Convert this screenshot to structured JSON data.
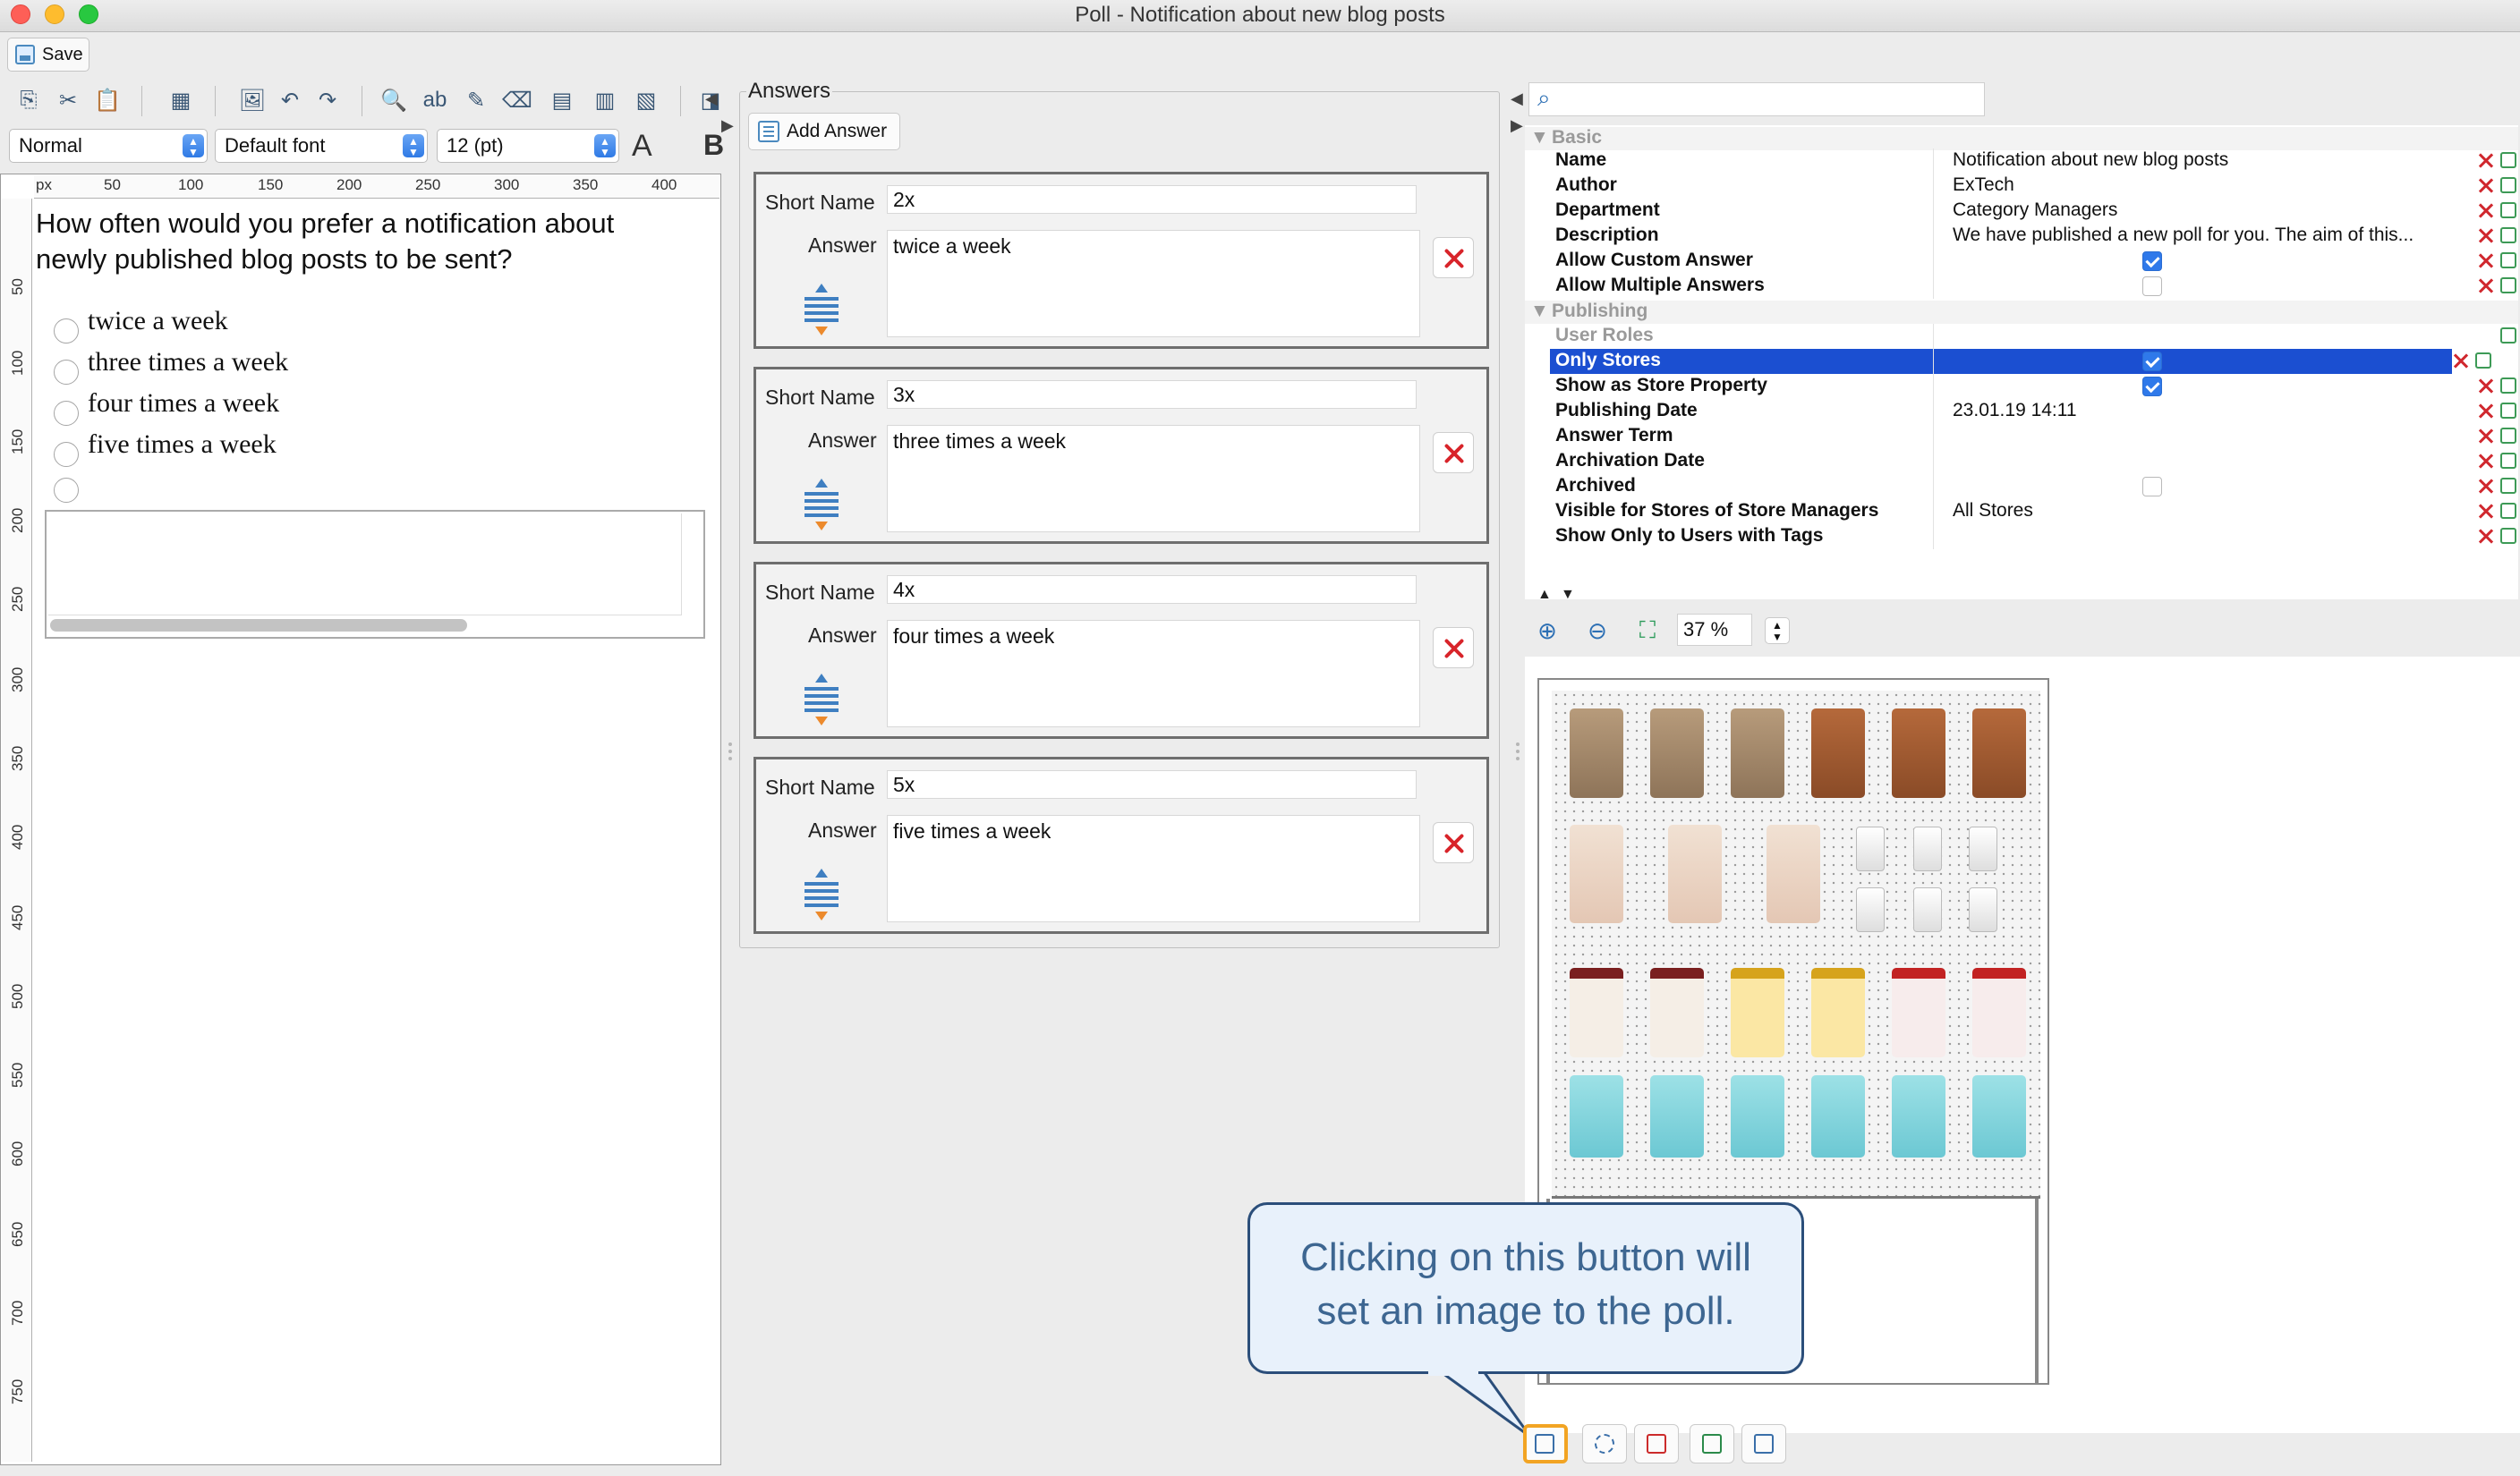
{
  "window": {
    "title": "Poll - Notification about new blog posts"
  },
  "toolbar": {
    "save_label": "Save"
  },
  "format": {
    "style": "Normal",
    "font": "Default font",
    "size": "12 (pt)"
  },
  "ruler": {
    "unit": "px",
    "h_ticks": [
      "50",
      "100",
      "150",
      "200",
      "250",
      "300",
      "350",
      "400"
    ],
    "v_ticks": [
      "50",
      "100",
      "150",
      "200",
      "250",
      "300",
      "350",
      "400",
      "450",
      "500",
      "550",
      "600",
      "650",
      "700",
      "750"
    ]
  },
  "editor": {
    "question": "How often would you prefer a notification about newly published blog posts to be sent?",
    "options": [
      "twice a week",
      "three times a week",
      "four times a week",
      "five times a week"
    ]
  },
  "answers": {
    "title": "Answers",
    "add_label": "Add Answer",
    "short_name_label": "Short Name",
    "answer_label": "Answer",
    "items": [
      {
        "short": "2x",
        "text": "twice a week"
      },
      {
        "short": "3x",
        "text": "three times a week"
      },
      {
        "short": "4x",
        "text": "four times a week"
      },
      {
        "short": "5x",
        "text": "five times a week"
      }
    ]
  },
  "properties": {
    "search_value": "",
    "basic": {
      "title": "Basic",
      "rows": [
        {
          "name": "Name",
          "value": "Notification about new blog posts"
        },
        {
          "name": "Author",
          "value": "ExTech"
        },
        {
          "name": "Department",
          "value": "Category Managers"
        },
        {
          "name": "Description",
          "value": "We have published a new poll for you. The aim of this..."
        },
        {
          "name": "Allow Custom Answer",
          "value": "",
          "checked": true
        },
        {
          "name": "Allow Multiple Answers",
          "value": "",
          "checked": false
        }
      ]
    },
    "publishing": {
      "title": "Publishing",
      "rows": [
        {
          "name": "User Roles",
          "value": ""
        },
        {
          "name": "Only Stores",
          "value": "",
          "checked": true,
          "selected": true
        },
        {
          "name": "Show as Store Property",
          "value": "",
          "checked": true
        },
        {
          "name": "Publishing Date",
          "value": "23.01.19 14:11"
        },
        {
          "name": "Answer Term",
          "value": ""
        },
        {
          "name": "Archivation Date",
          "value": ""
        },
        {
          "name": "Archived",
          "value": "",
          "checked": false
        },
        {
          "name": "Visible for Stores of Store Managers",
          "value": "All Stores"
        },
        {
          "name": "Show Only to Users with Tags",
          "value": ""
        }
      ]
    }
  },
  "image": {
    "zoom": "37 %"
  },
  "callout": {
    "line1": "Clicking on this button will",
    "line2": "set an image to the poll."
  }
}
